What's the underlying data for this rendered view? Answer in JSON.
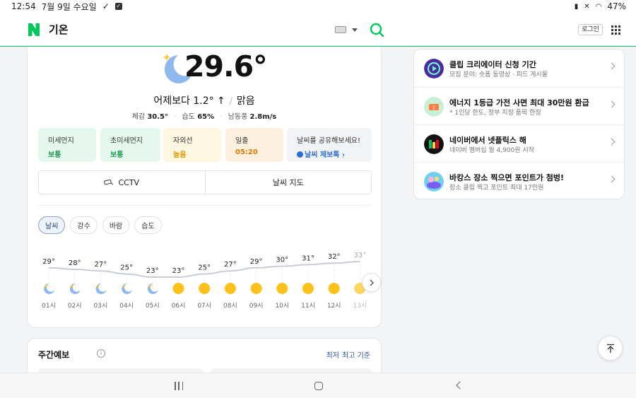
{
  "status_bar": {
    "time": "12:54",
    "date": "7월 9일 수요일",
    "battery": "47%"
  },
  "header": {
    "title": "기온",
    "login_label": "로그인"
  },
  "current": {
    "temperature": "29.6°",
    "compare": "어제보다 1.2° ↑",
    "condition": "맑음",
    "feels_label": "체감",
    "feels_value": "30.5°",
    "humidity_label": "습도",
    "humidity_value": "65%",
    "wind_label": "남동풍",
    "wind_value": "2.8m/s"
  },
  "tiles": [
    {
      "label": "미세먼지",
      "value": "보통"
    },
    {
      "label": "초미세먼지",
      "value": "보통"
    },
    {
      "label": "자외선",
      "value": "높음"
    },
    {
      "label": "일출",
      "value": "05:20"
    },
    {
      "label": "날씨를 공유해보세요!",
      "value": "날씨 제보톡 ›"
    }
  ],
  "segment": {
    "cctv": "CCTV",
    "map": "날씨 지도"
  },
  "chips": [
    "날씨",
    "강수",
    "바람",
    "습도"
  ],
  "hourly": {
    "hours": [
      "01시",
      "02시",
      "03시",
      "04시",
      "05시",
      "06시",
      "07시",
      "08시",
      "09시",
      "10시",
      "11시",
      "12시",
      "13시"
    ],
    "temps": [
      29,
      28,
      27,
      25,
      23,
      23,
      25,
      27,
      29,
      30,
      31,
      32,
      33
    ],
    "temp_labels": [
      "29°",
      "28°",
      "27°",
      "25°",
      "23°",
      "23°",
      "25°",
      "27°",
      "29°",
      "30°",
      "31°",
      "32°",
      "33°"
    ],
    "icons": [
      "moon-icon",
      "moon-icon",
      "moon-icon",
      "moon-icon",
      "moon-icon",
      "sun-icon",
      "sun-icon",
      "sun-icon",
      "sun-icon",
      "sun-icon",
      "sun-icon",
      "sun-icon",
      "sun-icon"
    ]
  },
  "weekly": {
    "title": "주간예보",
    "opt_low": "최저",
    "opt_high": "최고 기준"
  },
  "ads": [
    {
      "title": "클립 크리에이터 신청 기간",
      "sub": "모집 분야: 숏폼 동영상 · 피드 게시물",
      "icon": "clip-icon"
    },
    {
      "title": "에너지 1등급 가전 사면 최대 30만원 환급",
      "sub": "* 1인당 한도, 정부 지정 품목 한정",
      "icon": "energy-icon"
    },
    {
      "title": "네이버에서 넷플릭스 해",
      "sub": "네이버 멤버십 월 4,900원 시작",
      "icon": "netflix-icon"
    },
    {
      "title": "바캉스 장소 찍으면 포인트가 첨벙!",
      "sub": "장소 클립 찍고 포인트 최대 17만원",
      "icon": "vacation-icon"
    }
  ],
  "colors": {
    "naver_green": "#03c75a",
    "link_blue": "#2b55a8",
    "sun": "#ffc21a",
    "moon": "#8fb8ee"
  }
}
